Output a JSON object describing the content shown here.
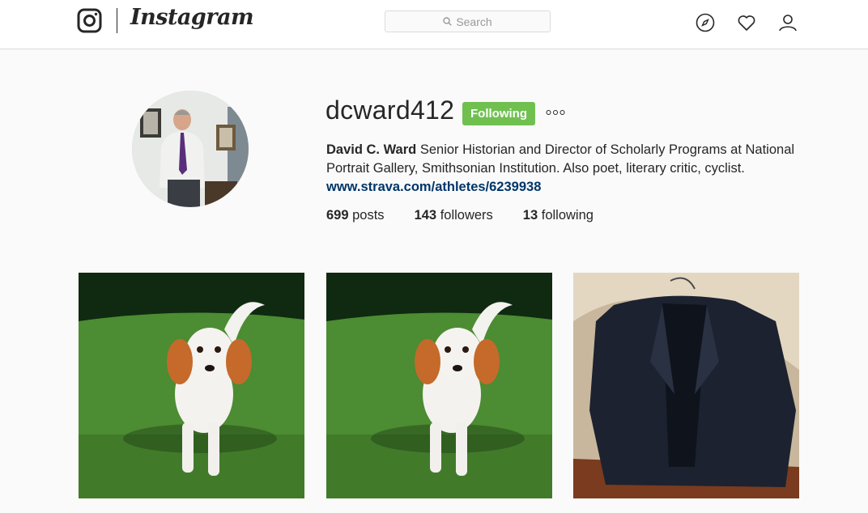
{
  "header": {
    "logo_icon": "instagram-camera-icon",
    "wordmark": "Instagram",
    "search": {
      "placeholder": "Search",
      "icon": "search-icon"
    },
    "nav_icons": [
      "compass-icon",
      "heart-icon",
      "user-icon"
    ]
  },
  "profile": {
    "username": "dcward412",
    "follow_button": "Following",
    "more_icon": "more-options-icon",
    "full_name": "David C. Ward",
    "bio": "Senior Historian and Director of Scholarly Programs at National Portrait Gallery, Smithsonian Institution. Also poet, literary critic, cyclist.",
    "link": "www.strava.com/athletes/6239938",
    "stats": {
      "posts_count": "699",
      "posts_label": "posts",
      "followers_count": "143",
      "followers_label": "followers",
      "following_count": "13",
      "following_label": "following"
    }
  },
  "posts": [
    {
      "subject": "puppy-photo"
    },
    {
      "subject": "puppy-photo"
    },
    {
      "subject": "jacket-photo"
    }
  ],
  "colors": {
    "follow_button": "#70c050",
    "link": "#003569",
    "background": "#fafafa",
    "border": "#dbdbdb"
  }
}
